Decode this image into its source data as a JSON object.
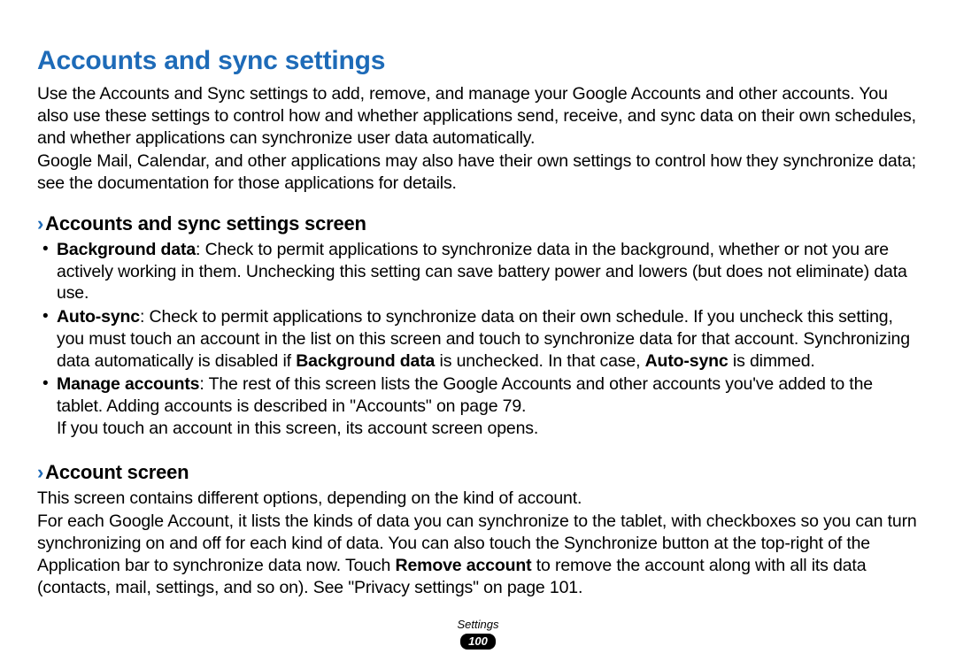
{
  "heading": "Accounts and sync settings",
  "intro_p1": "Use the Accounts and Sync settings to add, remove, and manage your Google Accounts and other accounts. You also use these settings to control how and whether applications send, receive, and sync data on their own schedules, and whether applications can synchronize user data automatically.",
  "intro_p2": "Google Mail, Calendar, and other applications may also have their own settings to control how they synchronize data; see the documentation for those applications for details.",
  "sub1": {
    "title": "Accounts and sync settings screen",
    "bullets": {
      "bg": {
        "label": "Background data",
        "text": ": Check to permit applications to synchronize data in the background, whether or not you are actively working in them. Unchecking this setting can save battery power and lowers (but does not eliminate) data use."
      },
      "auto": {
        "label": "Auto-sync",
        "text_a": ": Check to permit applications to synchronize data on their own schedule. If you uncheck this setting, you must touch an account in the list on this screen and touch to synchronize data for that account. Synchronizing data automatically is disabled if ",
        "bold_a": "Background data",
        "text_b": " is unchecked. In that case, ",
        "bold_b": "Auto-sync",
        "text_c": " is dimmed."
      },
      "manage": {
        "label": "Manage accounts",
        "text_a": ": The rest of this screen lists the Google Accounts and other accounts you've added to the tablet. Adding accounts is described in \"Accounts\" on page 79.",
        "text_b": "If you touch an account in this screen, its account screen opens."
      }
    }
  },
  "sub2": {
    "title": "Account screen",
    "p1": "This screen contains different options, depending on the kind of account.",
    "p2_a": "For each Google Account, it lists the kinds of data you can synchronize to the tablet, with checkboxes so you can turn synchronizing on and off for each kind of data. You can also touch the Synchronize button at the top-right of the Application bar to synchronize data now. Touch ",
    "p2_bold": "Remove account",
    "p2_b": " to remove the account along with all its data (contacts, mail, settings, and so on). See \"Privacy settings\" on page 101."
  },
  "footer": {
    "section": "Settings",
    "page": "100"
  }
}
